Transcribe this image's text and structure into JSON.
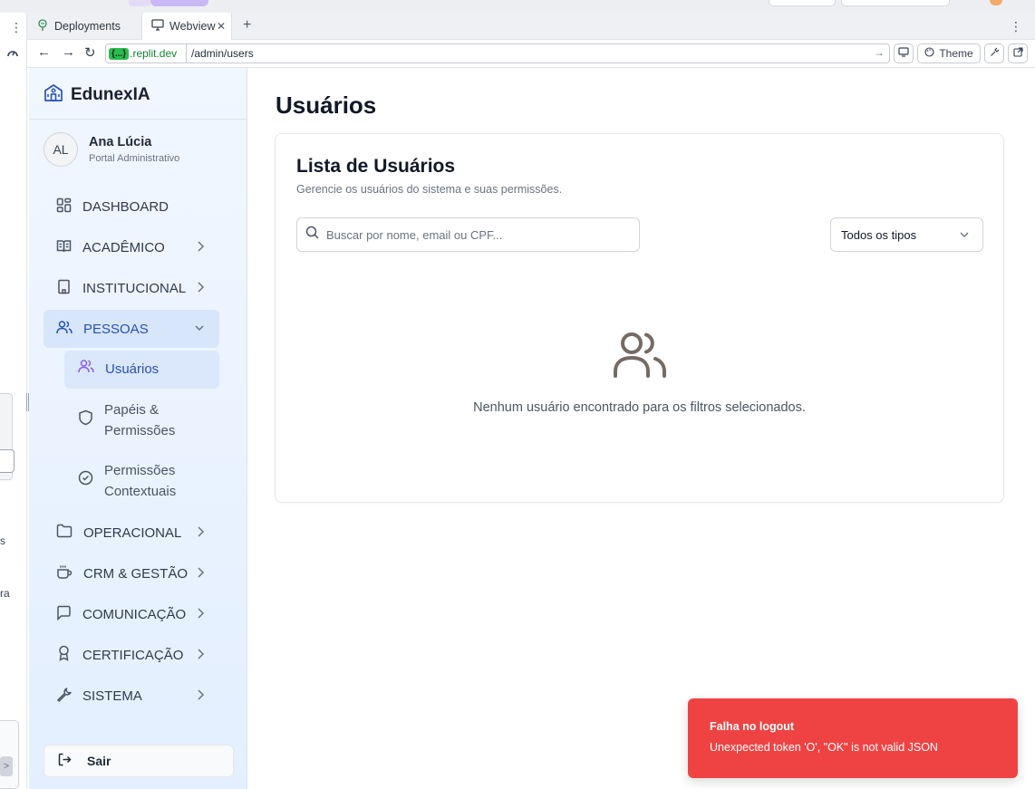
{
  "browser": {
    "tabs": [
      {
        "label": "Deployments"
      },
      {
        "label": "Webview"
      }
    ],
    "url_domain_badge": "{...}",
    "url_domain": ".replit.dev",
    "url_path": "/admin/users",
    "theme_label": "Theme"
  },
  "left_panel": {
    "text_1": "s",
    "text_2": "ra"
  },
  "sidebar": {
    "brand": "EdunexIA",
    "user": {
      "initials": "AL",
      "name": "Ana Lúcia",
      "role": "Portal Administrativo"
    },
    "items": [
      {
        "label": "DASHBOARD",
        "icon": "dashboard-icon"
      },
      {
        "label": "ACADÊMICO",
        "icon": "book-icon"
      },
      {
        "label": "INSTITUCIONAL",
        "icon": "building-icon"
      },
      {
        "label": "PESSOAS",
        "icon": "users-icon",
        "expanded": true
      },
      {
        "label": "OPERACIONAL",
        "icon": "folder-icon"
      },
      {
        "label": "CRM & GESTÃO",
        "icon": "coffee-icon"
      },
      {
        "label": "COMUNICAÇÃO",
        "icon": "message-icon"
      },
      {
        "label": "CERTIFICAÇÃO",
        "icon": "award-icon"
      },
      {
        "label": "SISTEMA",
        "icon": "wrench-icon"
      }
    ],
    "subitems": [
      {
        "label": "Usuários",
        "icon": "users-icon",
        "active": true
      },
      {
        "label_1": "Papéis &",
        "label_2": "Permissões",
        "icon": "shield-icon"
      },
      {
        "label_1": "Permissões",
        "label_2": "Contextuais",
        "icon": "check-circle-icon"
      }
    ],
    "logout": "Sair"
  },
  "main": {
    "title": "Usuários",
    "card_title": "Lista de Usuários",
    "card_subtitle": "Gerencie os usuários do sistema e suas permissões.",
    "search_placeholder": "Buscar por nome, email ou CPF...",
    "filter_selected": "Todos os tipos",
    "empty_message": "Nenhum usuário encontrado para os filtros selecionados."
  },
  "toast": {
    "title": "Falha no logout",
    "message": "Unexpected token 'O', \"OK\" is not valid JSON",
    "color": "#ef4343"
  },
  "colors": {
    "accent": "#2851b4",
    "sidebar_bg": "#e8f1ff"
  }
}
